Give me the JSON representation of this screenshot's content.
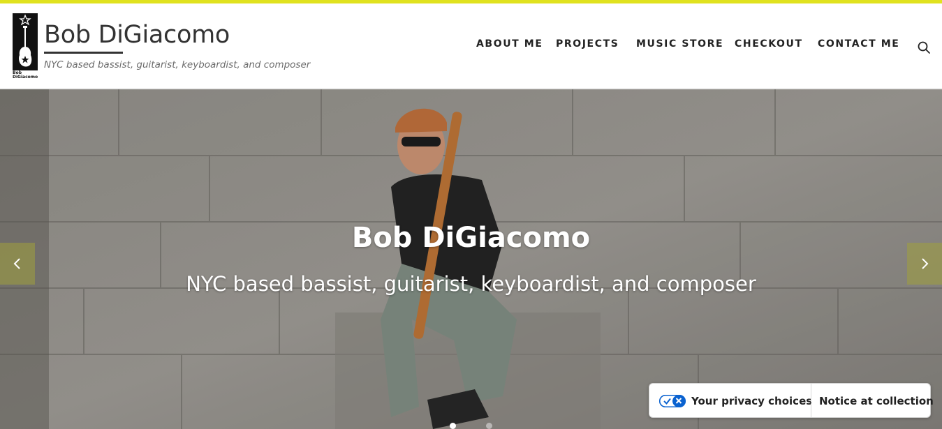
{
  "header": {
    "logo_text": "Bob DiGiacomo",
    "site_title": "Bob DiGiacomo",
    "tagline": "NYC based bassist, guitarist, keyboardist, and composer"
  },
  "nav": {
    "items": [
      {
        "label": "ABOUT ME"
      },
      {
        "label": "PROJECTS"
      },
      {
        "label": "MUSIC STORE"
      },
      {
        "label": "CHECKOUT"
      },
      {
        "label": "CONTACT ME"
      }
    ],
    "search_icon": "search-icon"
  },
  "hero": {
    "title": "Bob DiGiacomo",
    "subtitle": "NYC based bassist, guitarist, keyboardist, and composer",
    "prev_icon": "chevron-left-icon",
    "next_icon": "chevron-right-icon",
    "active_slide": 1,
    "slide_count": 2
  },
  "privacy": {
    "choices_label": "Your privacy choices",
    "notice_label": "Notice at collection",
    "toggle_icon": "privacy-toggle-icon"
  },
  "colors": {
    "accent": "#e0e21f",
    "text": "#222222",
    "privacy_blue": "#0a62d0"
  }
}
